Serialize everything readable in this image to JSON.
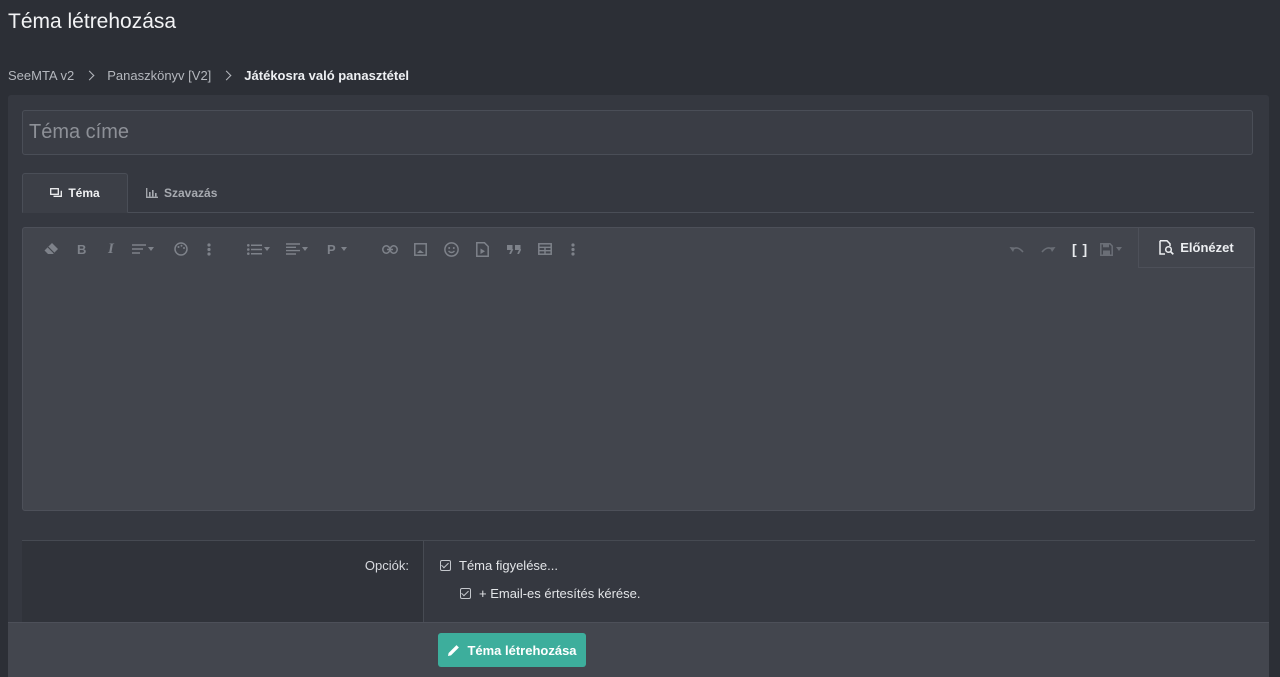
{
  "page": {
    "title": "Téma létrehozása"
  },
  "breadcrumb": [
    {
      "label": "SeeMTA v2"
    },
    {
      "label": "Panaszkönyv [V2]"
    },
    {
      "label": "Játékosra való panasztétel"
    }
  ],
  "form": {
    "title_input": {
      "placeholder": "Téma címe",
      "value": ""
    },
    "tabs": [
      {
        "label": "Téma",
        "icon": "comments-icon",
        "active": true
      },
      {
        "label": "Szavazás",
        "icon": "bar-chart-icon",
        "active": false
      }
    ],
    "editor": {
      "toolbar_left": [
        {
          "name": "eraser-icon",
          "dropdown": false
        },
        {
          "name": "bold-icon",
          "label": "B",
          "dropdown": false
        },
        {
          "name": "italic-icon",
          "label": "I",
          "dropdown": false
        },
        {
          "name": "text-style-icon",
          "dropdown": true
        },
        {
          "name": "palette-icon",
          "dropdown": false
        },
        {
          "name": "more-vertical-icon",
          "dropdown": false
        },
        {
          "name": "list-icon",
          "dropdown": true
        },
        {
          "name": "align-icon",
          "dropdown": true
        },
        {
          "name": "paragraph-icon",
          "label": "P",
          "dropdown": true
        },
        {
          "name": "link-icon",
          "dropdown": false
        },
        {
          "name": "image-icon",
          "dropdown": false
        },
        {
          "name": "smiley-icon",
          "dropdown": false
        },
        {
          "name": "media-icon",
          "dropdown": false
        },
        {
          "name": "quote-icon",
          "dropdown": false
        },
        {
          "name": "table-icon",
          "dropdown": false
        },
        {
          "name": "more-vertical-icon",
          "dropdown": false
        }
      ],
      "toolbar_right": [
        {
          "name": "undo-icon"
        },
        {
          "name": "redo-icon"
        },
        {
          "name": "bbcode-toggle-icon",
          "label": "[ ]"
        },
        {
          "name": "drafts-icon",
          "dropdown": true
        }
      ],
      "preview_label": "Előnézet",
      "content": ""
    },
    "options": {
      "label": "Opciók:",
      "watch_thread": {
        "label": "Téma figyelése...",
        "checked": true
      },
      "email_notify": {
        "label": "+ Email-es értesítés kérése.",
        "checked": true
      }
    },
    "submit_label": "Téma létrehozása"
  },
  "colors": {
    "background": "#2c2f36",
    "panel": "#353840",
    "editor": "#42454d",
    "accent": "#3dae9c"
  }
}
